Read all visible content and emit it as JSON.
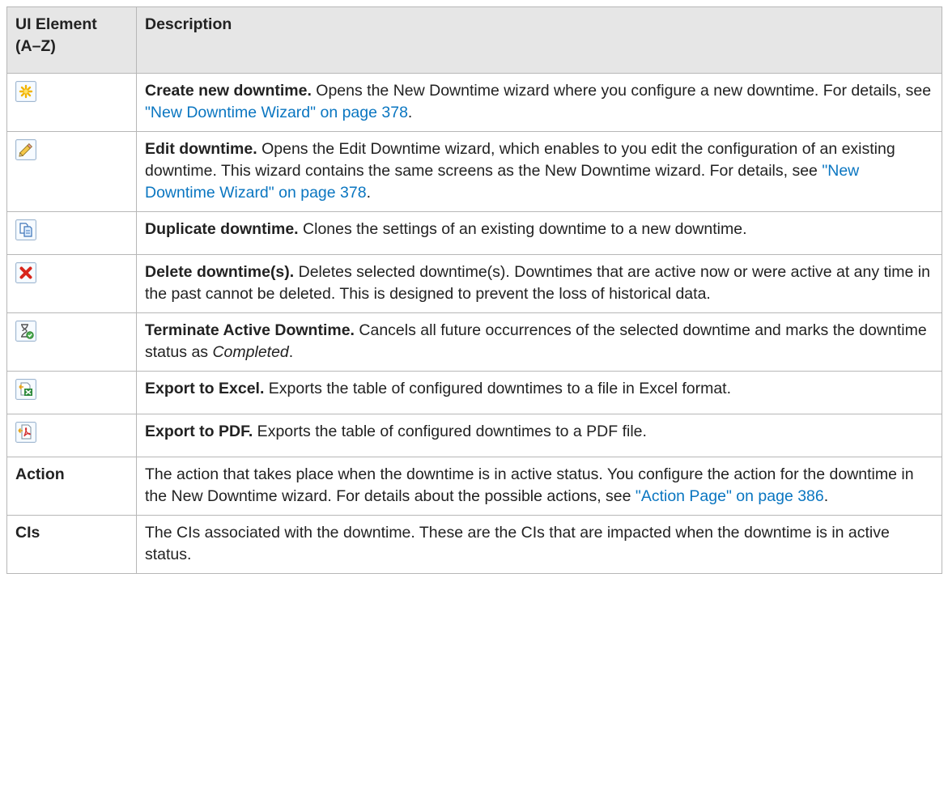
{
  "header": {
    "col1_line1": "UI Element",
    "col1_line2": "(A–Z)",
    "col2": "Description"
  },
  "rows": [
    {
      "icon": "create-new-icon",
      "title": "Create new downtime.",
      "text": " Opens the New Downtime wizard where you configure a new downtime. For details, see ",
      "link": "\"New Downtime Wizard\" on page 378",
      "after": "."
    },
    {
      "icon": "pencil-icon",
      "title": "Edit downtime.",
      "text": " Opens the Edit Downtime wizard, which enables to you edit the configuration of an existing downtime. This wizard contains the same screens as the New Downtime wizard. For details, see ",
      "link": "\"New Downtime Wizard\" on page 378",
      "after": "."
    },
    {
      "icon": "duplicate-icon",
      "title": "Duplicate downtime.",
      "text": " Clones the settings of an existing downtime to a new downtime."
    },
    {
      "icon": "delete-icon",
      "title": "Delete downtime(s).",
      "text": " Deletes selected downtime(s). Downtimes that are active now or were active at any time in the past cannot be deleted. This is designed to prevent the loss of historical data."
    },
    {
      "icon": "terminate-icon",
      "title": "Terminate Active Downtime.",
      "text": " Cancels all future occurrences of the selected downtime and marks the downtime status as ",
      "italic": "Completed",
      "after": "."
    },
    {
      "icon": "excel-export-icon",
      "title": "Export to Excel.",
      "text": " Exports the table of configured downtimes to a file in Excel format."
    },
    {
      "icon": "pdf-export-icon",
      "title": "Export to PDF.",
      "text": " Exports the table of configured downtimes to a PDF file."
    },
    {
      "label": "Action",
      "text": "The action that takes place when the downtime is in active status. You configure the action for the downtime in the New Downtime wizard. For details about the possible actions, see ",
      "link": "\"Action Page\" on page 386",
      "after": "."
    },
    {
      "label": "CIs",
      "text": "The CIs associated with the downtime. These are the CIs that are impacted when the downtime is in active status."
    }
  ]
}
